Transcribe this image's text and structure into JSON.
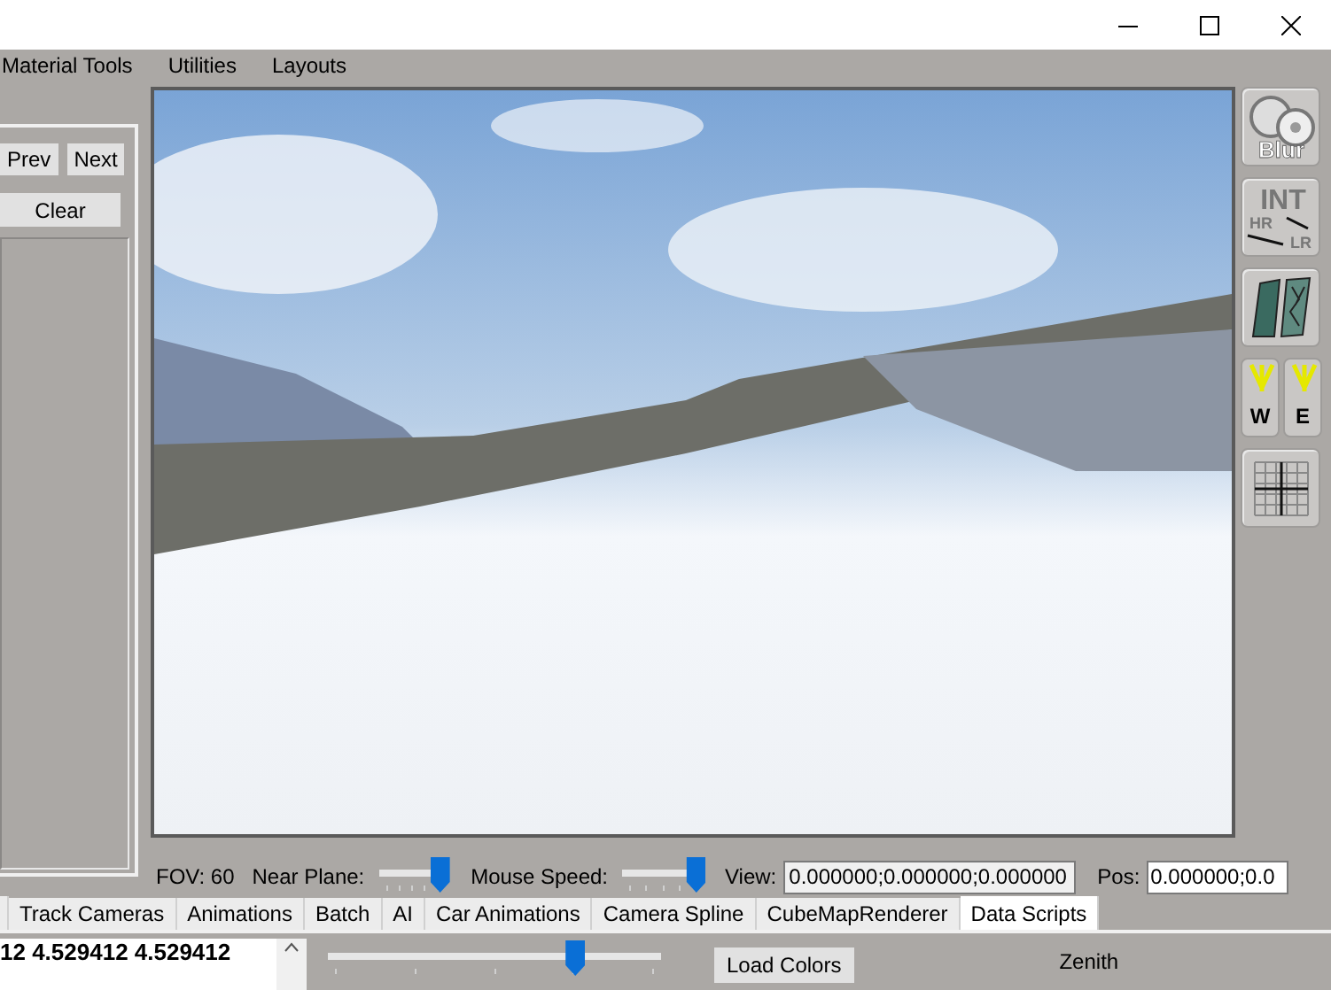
{
  "menu": [
    "Material Tools",
    "Utilities",
    "Layouts"
  ],
  "left_panel": {
    "buttons": [
      "Prev",
      "Next"
    ],
    "clear_button": "Clear"
  },
  "toolbar": [
    {
      "kind": "blur",
      "labels": [
        "Blur"
      ]
    },
    {
      "kind": "interpolate",
      "labels": [
        "INT",
        "HR",
        "LR"
      ]
    },
    {
      "kind": "tires"
    },
    {
      "kind": "wind",
      "labels": [
        "W",
        "E"
      ]
    },
    {
      "kind": "grid"
    }
  ],
  "camera_bar": {
    "fov": "FOV: 60",
    "near_plane": {
      "label": "Near Plane:",
      "level": 0.9
    },
    "mouse_speed": {
      "label": "Mouse Speed:",
      "level": 0.9
    },
    "view": {
      "label": "View:",
      "value": "0.000000;0.000000;0.000000"
    },
    "pos": {
      "label": "Pos:",
      "value": "0.000000;0.0"
    }
  },
  "tabs": [
    {
      "label": "Track Cameras",
      "selected": false
    },
    {
      "label": "Animations",
      "selected": false
    },
    {
      "label": "Batch",
      "selected": false
    },
    {
      "label": "AI",
      "selected": false
    },
    {
      "label": "Car Animations",
      "selected": false
    },
    {
      "label": "Camera Spline",
      "selected": false
    },
    {
      "label": "CubeMapRenderer",
      "selected": false
    },
    {
      "label": "Data Scripts",
      "selected": true
    }
  ],
  "bottom_panel": {
    "list_rows": [
      "12 4.529412 4.529412"
    ],
    "slider": {
      "level": 0.74
    },
    "load_button": "Load Colors",
    "zenith_label": "Zenith"
  }
}
